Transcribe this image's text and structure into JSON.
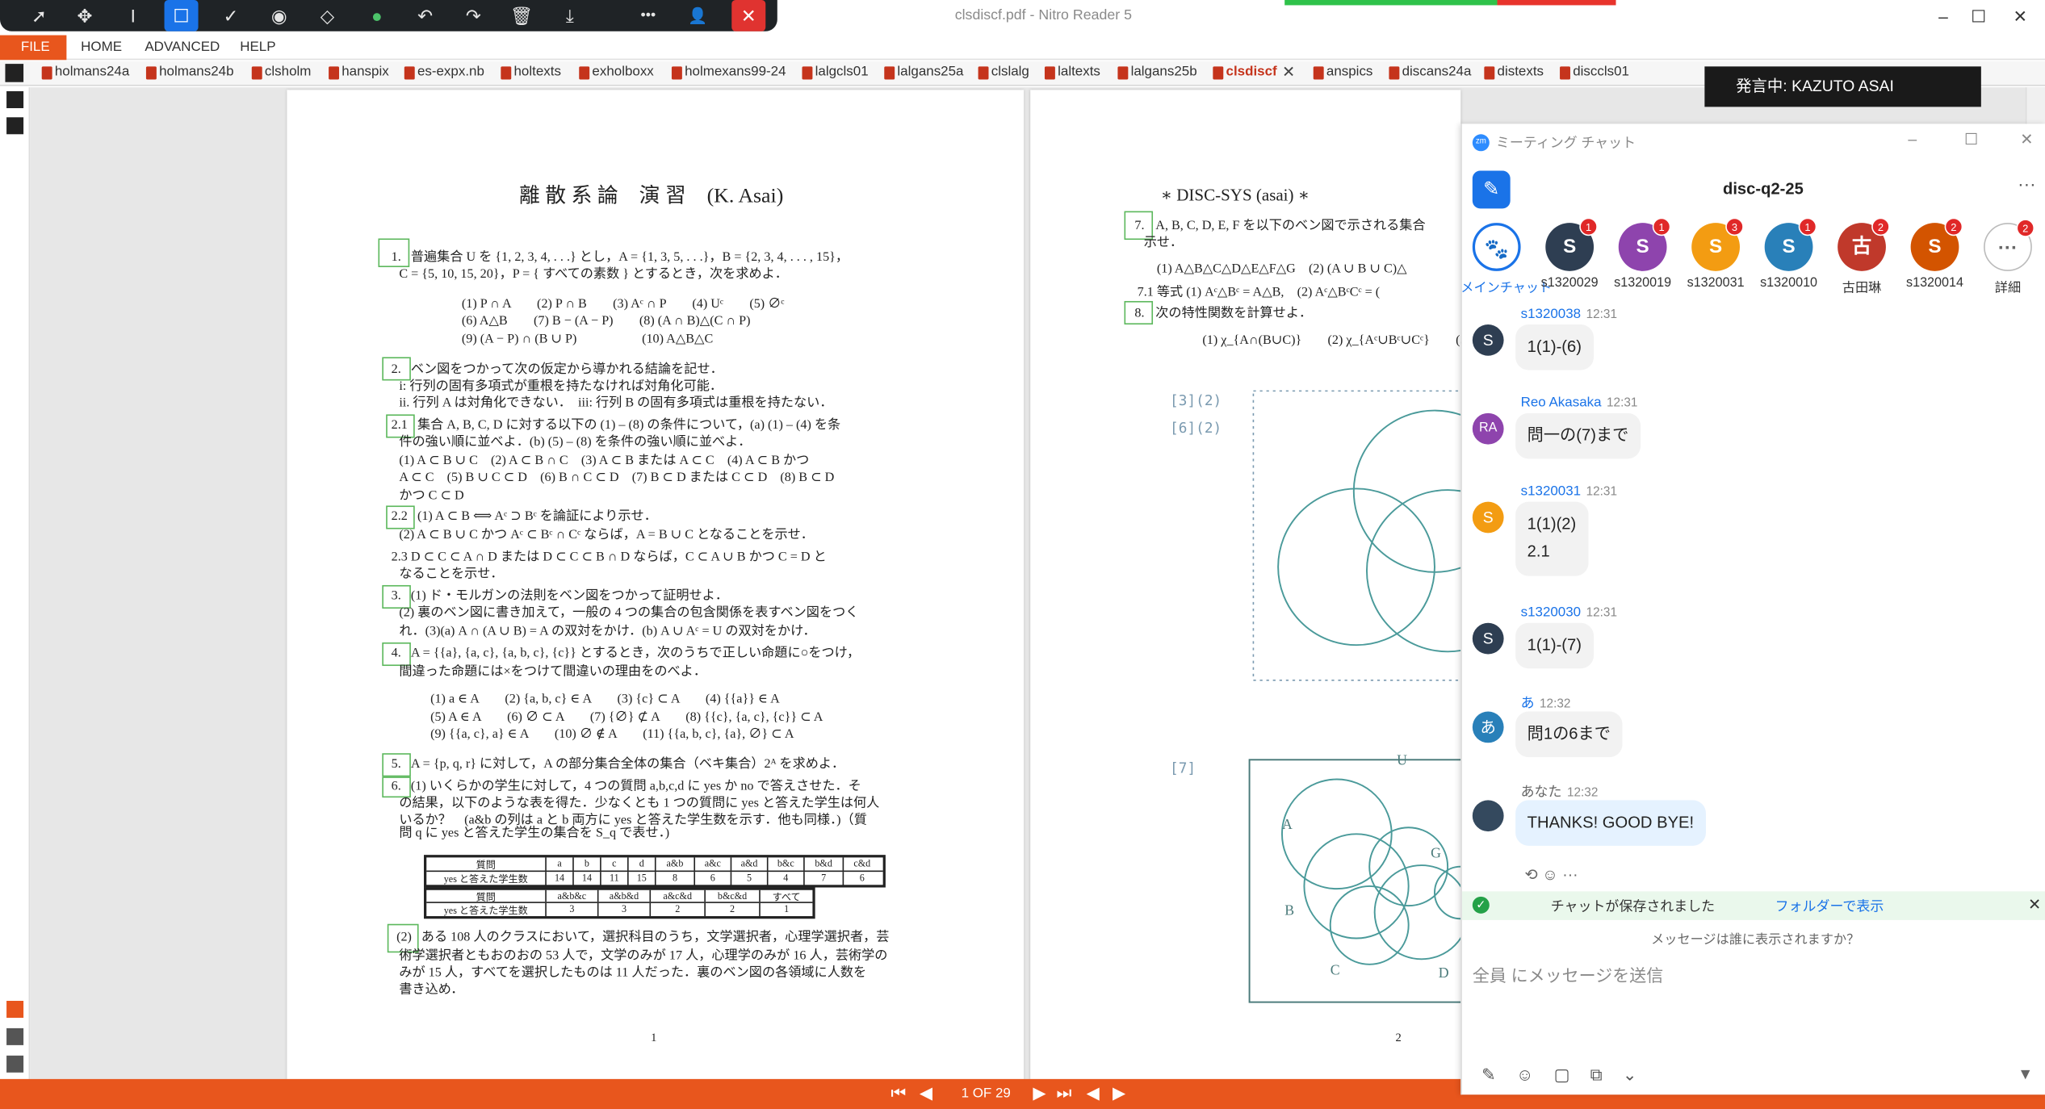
{
  "window": {
    "title": "clsdiscf.pdf - Nitro Reader 5",
    "controls": {
      "minimize": "–",
      "maximize": "☐",
      "close": "✕"
    }
  },
  "annotation_toolbar": {
    "icons": [
      "pointer-icon",
      "move-icon",
      "text-cursor-icon",
      "rectangle-icon",
      "check-icon",
      "highlighter-icon",
      "eraser-icon",
      "circle-icon",
      "undo-icon",
      "redo-icon",
      "trash-icon",
      "download-icon",
      "more-icon",
      "user-icon",
      "close-icon"
    ],
    "glyphs": {
      "pointer": "➚",
      "move": "✥",
      "text": "I",
      "rect": "☐",
      "check": "✓",
      "spot": "◉",
      "eraser": "◇",
      "dot": "●",
      "undo": "↶",
      "redo": "↷",
      "trash": "🗑",
      "download": "⤓",
      "more": "•••",
      "user": "👤",
      "close": "✕"
    }
  },
  "menu": {
    "file": "FILE",
    "home": "HOME",
    "advanced": "ADVANCED",
    "help": "HELP"
  },
  "tabs": [
    "holmans24a",
    "holmans24b",
    "clsholm",
    "hanspix",
    "es-expx.nb",
    "holtexts",
    "exholboxx",
    "holmexans99-24",
    "lalgcls01",
    "lalgans25a",
    "clslalg",
    "laltexts",
    "lalgans25b",
    "clsdiscf",
    "anspics",
    "discans24a",
    "distexts",
    "disccls01"
  ],
  "active_tab": "clsdiscf",
  "page1": {
    "title": "離 散 系 論　演 習　(K. Asai)",
    "q1_num": "1.",
    "q1_line1": "普遍集合 U を {1, 2, 3, 4, . . .} とし，A = {1, 3, 5, . . .}，B = {2, 3, 4, . . . , 15}，",
    "q1_line2": "C = {5, 10, 15, 20}，P = { すべての素数 } とするとき，次を求めよ．",
    "q1_items1": "(1) P ∩ A　　(2) P ∩ B　　(3) Aᶜ ∩ P　　(4) Uᶜ　　(5) ∅ᶜ",
    "q1_items2": "(6) A△B　　(7) B − (A − P)　　(8) (A ∩ B)△(C ∩ P)",
    "q1_items3": "(9) (A − P) ∩ (B ∪ P)　　　　　(10) A△B△C",
    "q2_num": "2.",
    "q2_line1": "ベン図をつかって次の仮定から導かれる結論を記せ．",
    "q2_line2": "i: 行列の固有多項式が重根を持たなければ対角化可能．",
    "q2_line3": "ii. 行列 A は対角化できない．　iii: 行列 B の固有多項式は重根を持たない．",
    "q21_num": "2.1",
    "q21_line1": "集合 A, B, C, D に対する以下の (1) – (8) の条件について，(a) (1) – (4) を条",
    "q21_line2": "件の強い順に並べよ．(b) (5) – (8) を条件の強い順に並べよ．",
    "q21_line3": "(1) A ⊂ B ∪ C　(2) A ⊂ B ∩ C　(3) A ⊂ B または A ⊂ C　(4) A ⊂ B かつ",
    "q21_line4": "A ⊂ C　(5) B ∪ C ⊂ D　(6) B ∩ C ⊂ D　(7) B ⊂ D または C ⊂ D　(8) B ⊂ D",
    "q21_line5": "かつ C ⊂ D",
    "q22_num": "2.2",
    "q22_line1": "(1) A ⊂ B ⟺ Aᶜ ⊃ Bᶜ を論証により示せ．",
    "q22_line2": "(2) A ⊂ B ∪ C かつ Aᶜ ⊂ Bᶜ ∩ Cᶜ ならば，A = B ∪ C となることを示せ．",
    "q23_line1": "2.3 D ⊂ C ⊂ A ∩ D または D ⊂ C ⊂ B ∩ D ならば，C ⊂ A ∪ B かつ C = D と",
    "q23_line2": "なることを示せ．",
    "q3_num": "3.",
    "q3_line1": "(1) ド・モルガンの法則をベン図をつかって証明せよ．",
    "q3_line2": "(2) 裏のベン図に書き加えて，一般の 4 つの集合の包含関係を表すベン図をつく",
    "q3_line3": "れ．(3)(a) A ∩ (A ∪ B) = A の双対をかけ．(b) A ∪ Aᶜ = U の双対をかけ．",
    "q4_num": "4.",
    "q4_line1": "A = {{a}, {a, c}, {a, b, c}, {c}} とするとき，次のうちで正しい命題に○をつけ，",
    "q4_line2": "間違った命題には×をつけて間違いの理由をのべよ．",
    "q4_items1": "(1) a ∈ A　　(2) {a, b, c} ∈ A　　(3) {c} ⊂ A　　(4) {{a}} ∈ A",
    "q4_items2": "(5) A ∈ A　　(6) ∅ ⊂ A　　(7) {∅} ⊄ A　　(8) {{c}, {a, c}, {c}} ⊂ A",
    "q4_items3": "(9) {{a, c}, a} ∈ A　　(10) ∅ ∉ A　　(11) {{a, b, c}, {a}, ∅} ⊂ A",
    "q5_num": "5.",
    "q5_line1": "A = {p, q, r} に対して，A の部分集合全体の集合（ベキ集合）2ᴬ を求めよ．",
    "q6_num": "6.",
    "q6_line1": "(1) いくらかの学生に対して，4 つの質問 a,b,c,d に yes か no で答えさせた．そ",
    "q6_line2": "の結果，以下のような表を得た．少なくとも 1 つの質問に yes と答えた学生は何人",
    "q6_line3": "いるか？　(a&b の列は a と b 両方に yes と答えた学生数を示す．他も同様．)（質",
    "q6_line4": "問 q に yes と答えた学生の集合を S_q で表せ．)",
    "table1": {
      "headers": [
        "質問",
        "a",
        "b",
        "c",
        "d",
        "a&b",
        "a&c",
        "a&d",
        "b&c",
        "b&d",
        "c&d"
      ],
      "row": [
        "yes と答えた学生数",
        "14",
        "14",
        "11",
        "15",
        "8",
        "6",
        "5",
        "4",
        "7",
        "6"
      ]
    },
    "table2": {
      "headers": [
        "質問",
        "a&b&c",
        "a&b&d",
        "a&c&d",
        "b&c&d",
        "すべて"
      ],
      "row": [
        "yes と答えた学生数",
        "3",
        "3",
        "2",
        "2",
        "1"
      ]
    },
    "q62_num": "(2)",
    "q62_line1": "ある 108 人のクラスにおいて，選択科目のうち，文学選択者，心理学選択者，芸",
    "q62_line2": "術学選択者ともおのおの 53 人で，文学のみが 17 人，心理学のみが 16 人，芸術学の",
    "q62_line3": "みが 15 人，すべてを選択したものは 11 人だった．裏のベン図の各領域に人数を",
    "q62_line4": "書き込め．",
    "page_number": "1"
  },
  "page2": {
    "title": "∗ DISC-SYS (asai) ∗",
    "q7_num": "7.",
    "q7_line1": "A, B, C, D, E, F を以下のベン図で示される集合",
    "q7_line2": "示せ．",
    "q7_line3": "(1) A△B△C△D△E△F△G　(2) (A ∪ B ∪ C)△",
    "q71_line": "7.1 等式 (1) Aᶜ△Bᶜ = A△B,　(2) Aᶜ△BᶜCᶜ = (",
    "q8_num": "8.",
    "q8_line1": "次の特性関数を計算せよ．",
    "q8_items": "(1) χ_{A∩(B∪C)}　　(2) χ_{Aᶜ∪Bᶜ∪Cᶜ}　　(3) χ",
    "label_32": "[3](2)",
    "label_62": "[6](2)",
    "label_7": "[7]",
    "venn_labels": {
      "u": "U",
      "a": "A",
      "b": "B",
      "c": "C",
      "d": "D",
      "g": "G"
    },
    "page_number": "2"
  },
  "bottom": {
    "page_counter": "1 OF 29"
  },
  "speaking": "発言中: KAZUTO ASAI",
  "chat": {
    "window_title": "ミーティング チャット",
    "logo": "zm",
    "channel": "disc-q2-25",
    "more": "···",
    "participants": [
      {
        "name": "メインチャット",
        "initial": "🐾",
        "color": "#ffffff",
        "badge": ""
      },
      {
        "name": "s1320029",
        "initial": "S",
        "color": "#2e3e52",
        "badge": "1"
      },
      {
        "name": "s1320019",
        "initial": "S",
        "color": "#8e44ad",
        "badge": "1"
      },
      {
        "name": "s1320031",
        "initial": "S",
        "color": "#f39c12",
        "badge": "3"
      },
      {
        "name": "s1320010",
        "initial": "S",
        "color": "#2980b9",
        "badge": "1"
      },
      {
        "name": "古田琳",
        "initial": "古",
        "color": "#c0392b",
        "badge": "2"
      },
      {
        "name": "s1320014",
        "initial": "S",
        "color": "#d35400",
        "badge": "2"
      },
      {
        "name": "詳細",
        "initial": "···",
        "color": "#ffffff",
        "badge": "2"
      }
    ],
    "messages": [
      {
        "sender": "s1320038",
        "time": "12:31",
        "avatar": "S",
        "color": "#2e3e52",
        "lines": [
          "1(1)-(6)"
        ]
      },
      {
        "sender": "Reo Akasaka",
        "time": "12:31",
        "avatar": "RA",
        "color": "#8e44ad",
        "lines": [
          "問一の(7)まで"
        ]
      },
      {
        "sender": "s1320031",
        "time": "12:31",
        "avatar": "S",
        "color": "#f39c12",
        "lines": [
          "1(1)(2)",
          "2.1"
        ]
      },
      {
        "sender": "s1320030",
        "time": "12:31",
        "avatar": "S",
        "color": "#2e3e52",
        "lines": [
          "1(1)-(7)"
        ]
      },
      {
        "sender": "あ",
        "time": "12:32",
        "avatar": "あ",
        "color": "#2980b9",
        "lines": [
          "問1の6まで"
        ]
      },
      {
        "sender": "あなた",
        "time": "12:32",
        "avatar": "",
        "color": "#34495e",
        "lines": [
          "THANKS! GOOD BYE!"
        ]
      }
    ],
    "reactions": "⟲ ☺ ···",
    "saved_text": "チャットが保存されました",
    "saved_link": "フォルダーで表示",
    "who_can_see": "メッセージは誰に表示されますか？",
    "input_placeholder": "全員 にメッセージを送信",
    "compose_icons": "✎ ☺ ▢ ⧉ ⌄"
  }
}
